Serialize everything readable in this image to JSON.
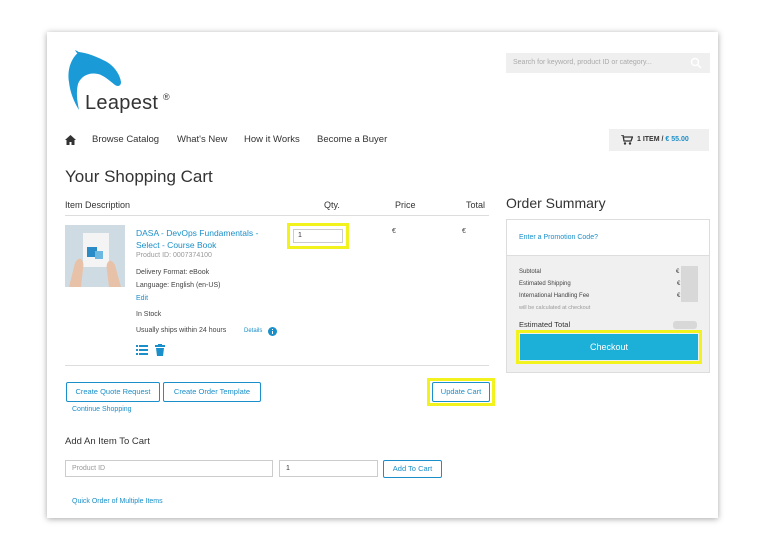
{
  "brand": {
    "name": "Leapest",
    "registered": "®"
  },
  "search": {
    "placeholder": "Search for keyword, product ID or category..."
  },
  "nav": {
    "items": [
      {
        "label": "Browse Catalog"
      },
      {
        "label": "What's New"
      },
      {
        "label": "How it Works"
      },
      {
        "label": "Become a Buyer"
      }
    ]
  },
  "cart": {
    "count_label": "1 ITEM",
    "separator": " / ",
    "total": "€ 55.00"
  },
  "page": {
    "title": "Your Shopping Cart"
  },
  "table": {
    "headers": {
      "description": "Item Description",
      "qty": "Qty.",
      "price": "Price",
      "total": "Total"
    },
    "item": {
      "title": "DASA - DevOps Fundamentals - Select - Course Book",
      "product_id": "Product ID: 0007374100",
      "delivery": "Delivery Format: eBook",
      "language": "Language: English (en-US)",
      "edit": "Edit",
      "stock": "In Stock",
      "ships": "Usually ships within 24 hours",
      "details": "Details",
      "qty": "1",
      "price": "€",
      "total": "€"
    }
  },
  "actions": {
    "quote": "Create Quote Request",
    "template": "Create Order Template",
    "update": "Update Cart",
    "continue": "Continue Shopping"
  },
  "add_item": {
    "heading": "Add An Item To Cart",
    "product_placeholder": "Product ID",
    "qty_value": "1",
    "button": "Add To Cart",
    "quick_order": "Quick Order of Multiple Items"
  },
  "summary": {
    "heading": "Order Summary",
    "promo": "Enter a Promotion Code?",
    "subtotal": "Subtotal",
    "shipping": "Estimated Shipping",
    "handling": "International Handling Fee",
    "calc_note": "will be calculated at checkout",
    "estimated_total": "Estimated Total",
    "currency": "€",
    "checkout": "Checkout"
  },
  "colors": {
    "accent": "#1a8fc9",
    "checkout": "#1cafd8",
    "highlight": "#f2f21f"
  }
}
